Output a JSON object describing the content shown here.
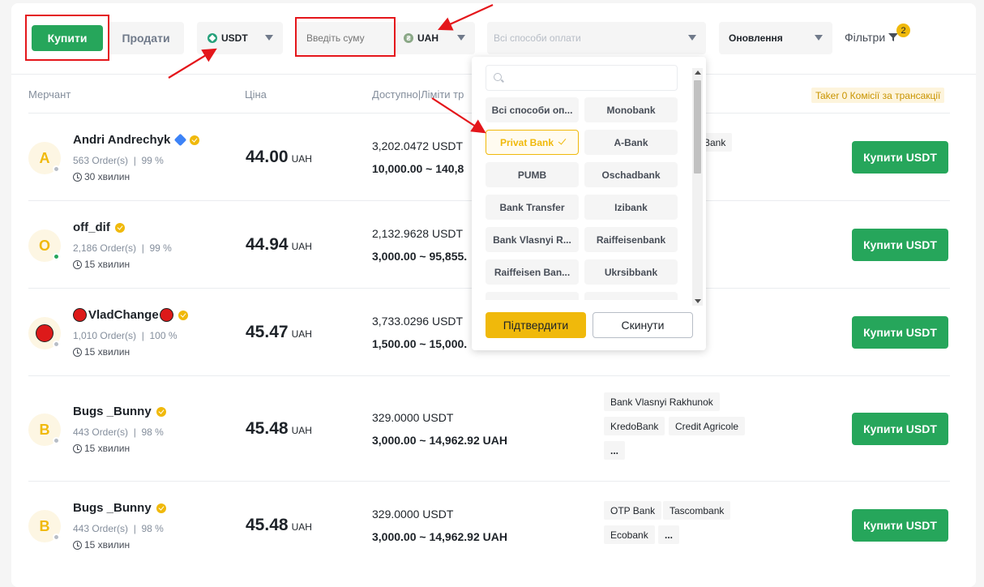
{
  "toolbar": {
    "buy_label": "Купити",
    "sell_label": "Продати",
    "asset": "USDT",
    "amount_placeholder": "Введіть суму",
    "fiat": "UAH",
    "payment_placeholder": "Всі способи оплати",
    "refresh": "Оновлення",
    "filters_label": "Фільтри",
    "filters_count": "2"
  },
  "headers": {
    "merchant": "Мерчант",
    "price": "Ціна",
    "available": "Доступно|Ліміти тр",
    "taker": "Taker 0 Комісії за трансакції"
  },
  "rows": [
    {
      "initial": "A",
      "name": "Andri Andrechyk",
      "orders": "563 Order(s)",
      "completion": "99 %",
      "time": "30 хвилин",
      "price": "44.00",
      "currency": "UAH",
      "available": "3,202.0472 USDT",
      "limit": "10,000.00 ~ 140,8",
      "methods": [
        "Bank"
      ],
      "buy": "Купити USDT"
    },
    {
      "initial": "O",
      "name": "off_dif",
      "orders": "2,186 Order(s)",
      "completion": "99 %",
      "time": "15 хвилин",
      "price": "44.94",
      "currency": "UAH",
      "available": "2,132.9628 USDT",
      "limit": "3,000.00 ~ 95,855.",
      "methods": [],
      "buy": "Купити USDT"
    },
    {
      "initial": "",
      "name": "VladChange",
      "orders": "1,010 Order(s)",
      "completion": "100 %",
      "time": "15 хвилин",
      "price": "45.47",
      "currency": "UAH",
      "available": "3,733.0296 USDT",
      "limit": "1,500.00 ~ 15,000.",
      "methods": [],
      "buy": "Купити USDT"
    },
    {
      "initial": "B",
      "name": "Bugs _Bunny",
      "orders": "443 Order(s)",
      "completion": "98 %",
      "time": "15 хвилин",
      "price": "45.48",
      "currency": "UAH",
      "available": "329.0000 USDT",
      "limit": "3,000.00 ~ 14,962.92 UAH",
      "methods": [
        "Bank Vlasnyi Rakhunok",
        "KredoBank",
        "Credit Agricole",
        "..."
      ],
      "buy": "Купити USDT"
    },
    {
      "initial": "B",
      "name": "Bugs _Bunny",
      "orders": "443 Order(s)",
      "completion": "98 %",
      "time": "15 хвилин",
      "price": "45.48",
      "currency": "UAH",
      "available": "329.0000 USDT",
      "limit": "3,000.00 ~ 14,962.92 UAH",
      "methods": [
        "OTP Bank",
        "Tascombank",
        "Ecobank",
        "..."
      ],
      "buy": "Купити USDT"
    }
  ],
  "dropdown": {
    "options": [
      "Всі способи оп...",
      "Monobank",
      "Privat Bank",
      "A-Bank",
      "PUMB",
      "Oschadbank",
      "Bank Transfer",
      "Izibank",
      "Bank Vlasnyi R...",
      "Raiffeisenbank",
      "Raiffeisen Ban...",
      "Ukrsibbank"
    ],
    "selected": "Privat Bank",
    "confirm": "Підтвердити",
    "reset": "Скинути"
  },
  "colors": {
    "accent_green": "#26a65b",
    "accent_yellow": "#f0b90b",
    "annotation_red": "#e4161b"
  }
}
